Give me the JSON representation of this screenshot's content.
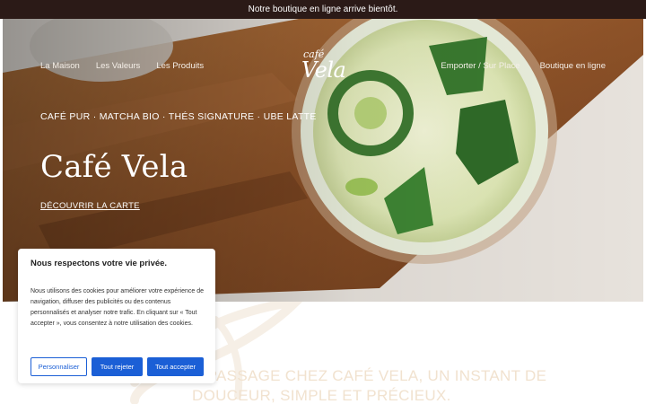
{
  "announcement": "Notre boutique en ligne arrive bientôt.",
  "nav": {
    "left": [
      "La Maison",
      "Les Valeurs",
      "Les Produits"
    ],
    "right": [
      "Emporter / Sur Place",
      "Boutique en ligne"
    ]
  },
  "logo": {
    "script": "café",
    "word": "Vela"
  },
  "hero": {
    "tagline": "CAFÉ PUR · MATCHA BIO · THÉS SIGNATURE · UBE LATTE",
    "title": "Café Vela",
    "cta": "DÉCOUVRIR LA CARTE"
  },
  "intro": {
    "line1": "E PASSAGE CHEZ CAFÉ VELA, UN INSTANT DE",
    "line2": "DOUCEUR, SIMPLE ET PRÉCIEUX."
  },
  "cookie": {
    "title": "Nous respectons votre vie privée.",
    "body": "Nous utilisons des cookies pour améliorer votre expérience de navigation, diffuser des publicités ou des contenus personnalisés et analyser notre trafic. En cliquant sur « Tout accepter », vous consentez à notre utilisation des cookies.",
    "customize": "Personnaliser",
    "reject": "Tout rejeter",
    "accept": "Tout accepter"
  },
  "colors": {
    "topbar": "#2b1a17",
    "button_blue": "#1b5fd6",
    "quote": "#f1e2cf"
  }
}
